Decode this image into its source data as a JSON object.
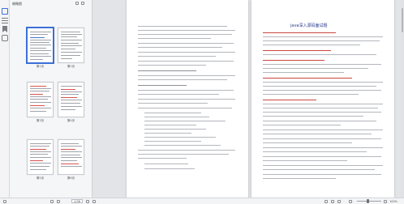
{
  "app": {
    "title": "缩略图"
  },
  "thumbnails": [
    {
      "label": "第1页",
      "selected": true
    },
    {
      "label": "第2页",
      "selected": false
    },
    {
      "label": "第3页",
      "selected": false
    },
    {
      "label": "第4页",
      "selected": false
    },
    {
      "label": "第5页",
      "selected": false
    },
    {
      "label": "第6页",
      "selected": false
    }
  ],
  "document": {
    "right_page_title": "java深入源码面试题"
  },
  "statusbar": {
    "page_indicator": "1/36",
    "zoom": "100%"
  },
  "colors": {
    "accent": "#3b6fd6",
    "title_text": "#2a3b8f",
    "highlight": "#c9473f"
  }
}
